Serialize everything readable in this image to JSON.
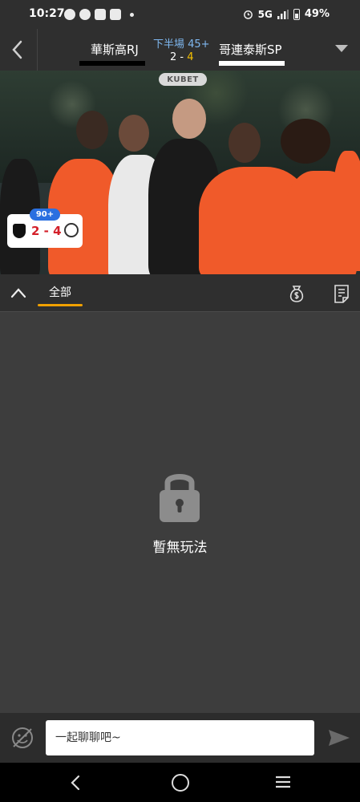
{
  "status_bar": {
    "time": "10:27",
    "network": "5G",
    "battery": "49%"
  },
  "header": {
    "home_team": "華斯高RJ",
    "away_team": "哥連泰斯SP",
    "period": "下半場 45+",
    "home_score": "2",
    "score_separator": " - ",
    "away_score": "4"
  },
  "video": {
    "sponsor_badge": "KUBET",
    "minute": "90+",
    "score_text": "2 - 4"
  },
  "tabs": {
    "all_label": "全部"
  },
  "empty_state": {
    "message": "暫無玩法"
  },
  "chat": {
    "placeholder": "一起聊聊吧~"
  },
  "colors": {
    "accent_tab": "#f0a000",
    "away_score": "#f5c000",
    "period": "#7fb8f0",
    "card_score": "#d4202a",
    "minute_badge": "#2a6fe0"
  }
}
